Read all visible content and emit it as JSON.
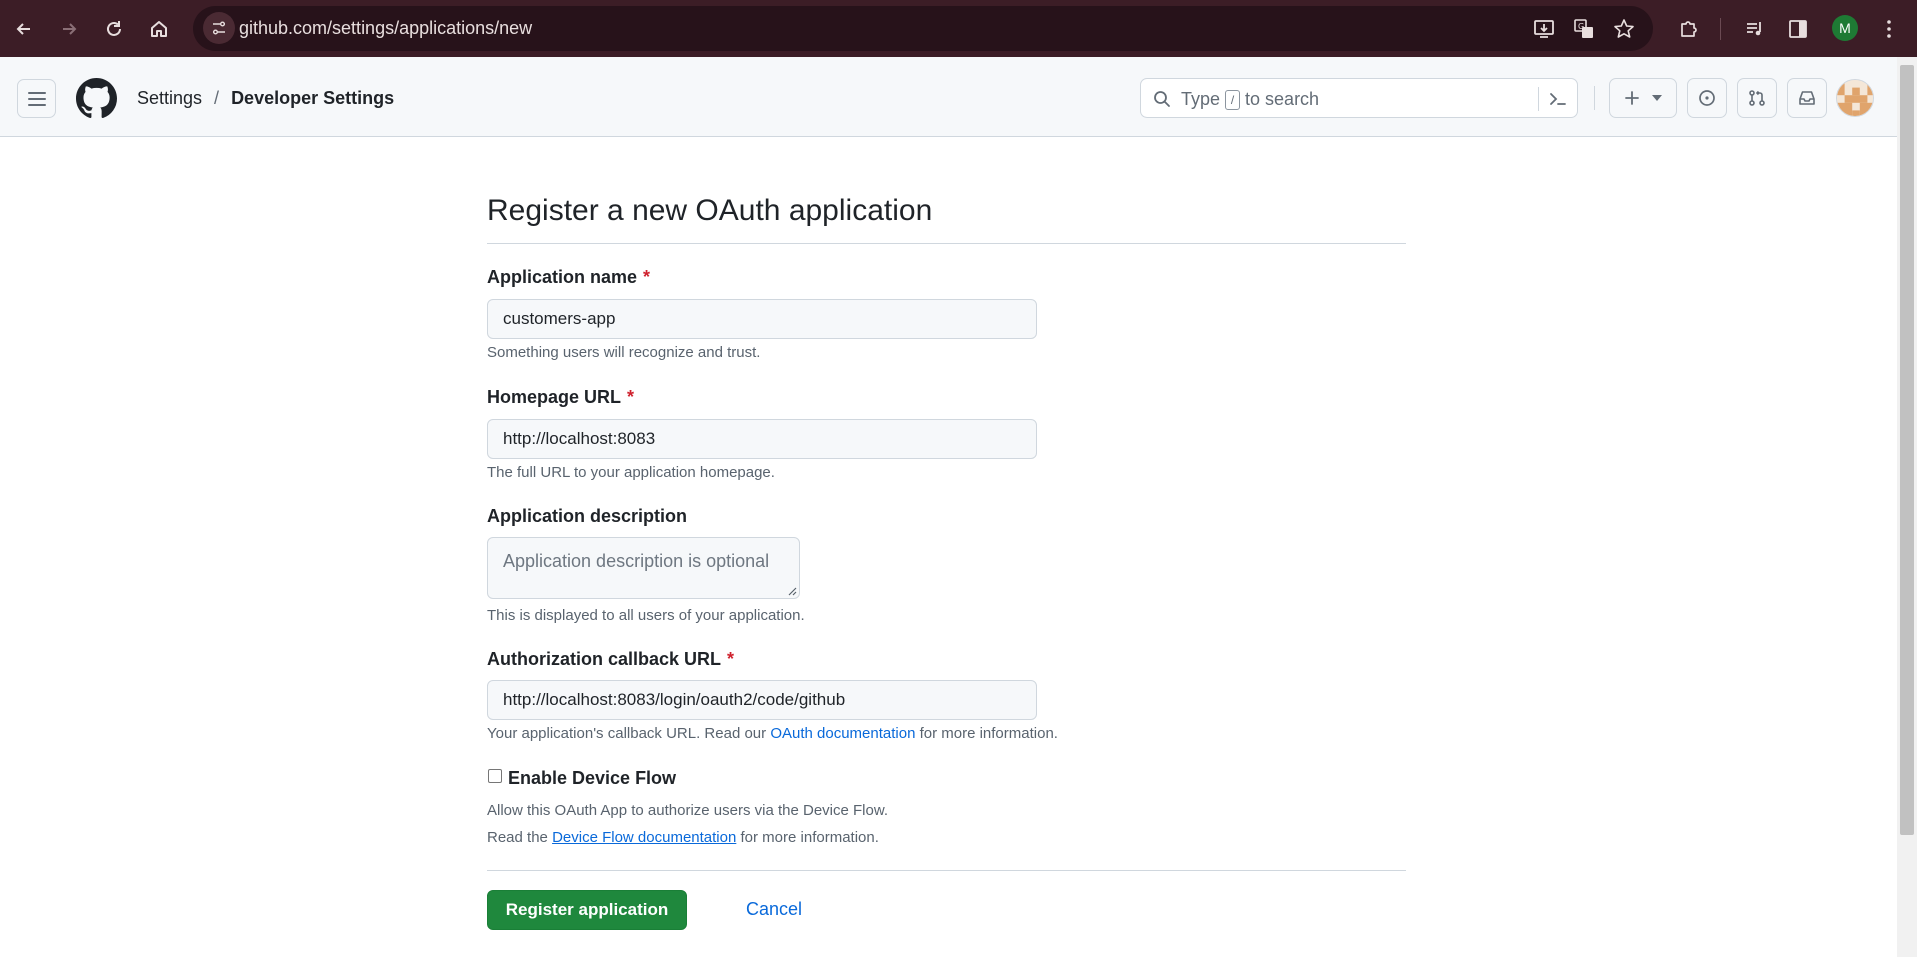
{
  "browser": {
    "url": "github.com/settings/applications/new",
    "profile_initial": "M"
  },
  "header": {
    "breadcrumb": [
      "Settings",
      "Developer Settings"
    ],
    "breadcrumb_separator": "/",
    "search": {
      "prefix": "Type",
      "key": "/",
      "suffix": "to search"
    }
  },
  "form": {
    "title": "Register a new OAuth application",
    "app_name": {
      "label": "Application name",
      "required_mark": "*",
      "value": "customers-app",
      "note": "Something users will recognize and trust."
    },
    "homepage": {
      "label": "Homepage URL",
      "required_mark": "*",
      "value": "http://localhost:8083",
      "note": "The full URL to your application homepage."
    },
    "description": {
      "label": "Application description",
      "placeholder": "Application description is optional",
      "note": "This is displayed to all users of your application."
    },
    "callback": {
      "label": "Authorization callback URL",
      "required_mark": "*",
      "value": "http://localhost:8083/login/oauth2/code/github",
      "note_before": "Your application's callback URL. Read our",
      "note_link": "OAuth documentation",
      "note_after": "for more information."
    },
    "device_flow": {
      "label": "Enable Device Flow",
      "checked": false,
      "note1": "Allow this OAuth App to authorize users via the Device Flow.",
      "note2_before": "Read the",
      "note2_link": "Device Flow documentation",
      "note2_after": "for more information."
    },
    "register_label": "Register application",
    "cancel_label": "Cancel"
  },
  "colors": {
    "chrome_bg": "#3c1d26",
    "primary_button": "#1f883d",
    "link": "#0969da",
    "required": "#cf222e"
  }
}
